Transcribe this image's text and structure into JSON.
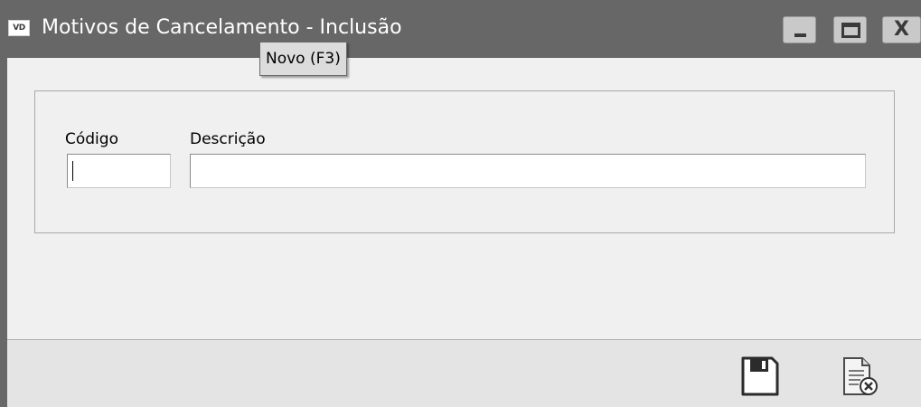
{
  "window": {
    "app_icon_text": "VD",
    "title": "Motivos de Cancelamento - Inclusão",
    "controls": {
      "minimize": "minimize-icon",
      "maximize": "maximize-icon",
      "close": "X"
    }
  },
  "tooltip": {
    "text": "Novo (F3)"
  },
  "form": {
    "codigo": {
      "label": "Código",
      "value": ""
    },
    "descricao": {
      "label": "Descrição",
      "value": ""
    }
  },
  "toolbar": {
    "save_icon": "floppy-disk-icon",
    "cancel_icon": "document-cancel-icon"
  }
}
